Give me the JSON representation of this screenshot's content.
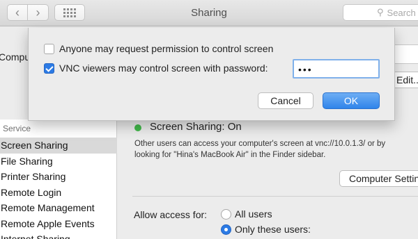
{
  "toolbar": {
    "title": "Sharing",
    "search_placeholder": "Search",
    "back_glyph": "‹",
    "forward_glyph": "›"
  },
  "background": {
    "computer_name_label": "Compute",
    "edit_button_label": "Edit...",
    "sidebar": {
      "header": "Service",
      "items": [
        {
          "label": "Screen Sharing",
          "selected": true
        },
        {
          "label": "File Sharing"
        },
        {
          "label": "Printer Sharing"
        },
        {
          "label": "Remote Login"
        },
        {
          "label": "Remote Management"
        },
        {
          "label": "Remote Apple Events"
        },
        {
          "label": "Internet Sharing"
        }
      ]
    },
    "status_text": "Screen Sharing: On",
    "description_line1": "Other users can access your computer's screen at vnc://10.0.1.3/ or by",
    "description_line2": "looking for \"Hina's MacBook Air\" in the Finder sidebar.",
    "computer_settings_label": "Computer Settings...",
    "allow_access_label": "Allow access for:",
    "radio_all_users": "All users",
    "radio_only_these": "Only these users:"
  },
  "sheet": {
    "option1_label": "Anyone may request permission to control screen",
    "option1_checked": false,
    "option2_label": "VNC viewers may control screen with password:",
    "option2_checked": true,
    "password_value": "•••",
    "cancel_label": "Cancel",
    "ok_label": "OK"
  },
  "colors": {
    "accent": "#2c7be5",
    "status_on": "#41b94a"
  },
  "icons": [
    "chevron-left-icon",
    "chevron-right-icon",
    "grid-icon",
    "search-icon"
  ]
}
